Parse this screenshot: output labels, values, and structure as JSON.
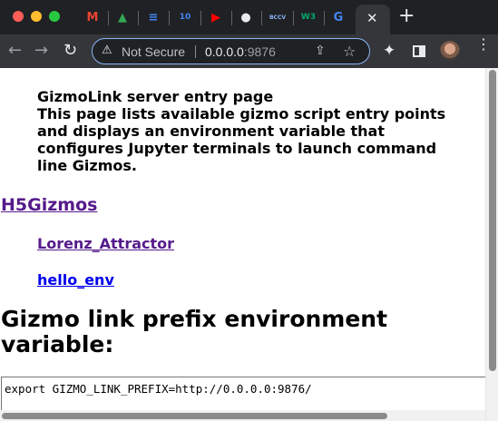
{
  "tabs": [
    {
      "icon": "gmail-icon",
      "glyph": "M",
      "color": "#ea4335"
    },
    {
      "icon": "google-drive-icon",
      "glyph": "▲",
      "color": "#34a853"
    },
    {
      "icon": "google-docs-icon",
      "glyph": "≡",
      "color": "#4285f4"
    },
    {
      "icon": "google-calendar-icon",
      "glyph": "10",
      "color": "#4285f4"
    },
    {
      "icon": "youtube-icon",
      "glyph": "▶",
      "color": "#ff0000"
    },
    {
      "icon": "github-icon",
      "glyph": "●",
      "color": "#e8eaed"
    },
    {
      "icon": "bccv-icon",
      "glyph": "BCCV",
      "color": "#8ab4f8"
    },
    {
      "icon": "w3schools-icon",
      "glyph": "W3",
      "color": "#04aa6d"
    },
    {
      "icon": "google-icon",
      "glyph": "G",
      "color": "#4285f4"
    }
  ],
  "active_tab": {
    "close_glyph": "✕"
  },
  "new_tab_glyph": "+",
  "toolbar": {
    "back_glyph": "←",
    "forward_glyph": "→",
    "reload_glyph": "↻",
    "security_label": "Not Secure",
    "url_host": "0.0.0.0",
    "url_port": ":9876",
    "share_glyph": "⇪",
    "star_glyph": "☆",
    "extensions_glyph": "✦",
    "menu_glyph": "⋮"
  },
  "page": {
    "intro_title": "GizmoLink server entry page",
    "intro_body": "This page lists available gizmo script entry points and displays an environment variable that configures Jupyter terminals to launch command line Gizmos.",
    "section_heading": "H5Gizmos",
    "links": [
      "Lorenz_Attractor",
      "hello_env"
    ],
    "env_heading": "Gizmo link prefix environment variable:",
    "env_value": "export GIZMO_LINK_PREFIX=http://0.0.0.0:9876/"
  },
  "colors": {
    "visited_link": "#551a8b",
    "unvisited_link": "#0000ee",
    "omnibox_focus": "#8ab4f8"
  }
}
